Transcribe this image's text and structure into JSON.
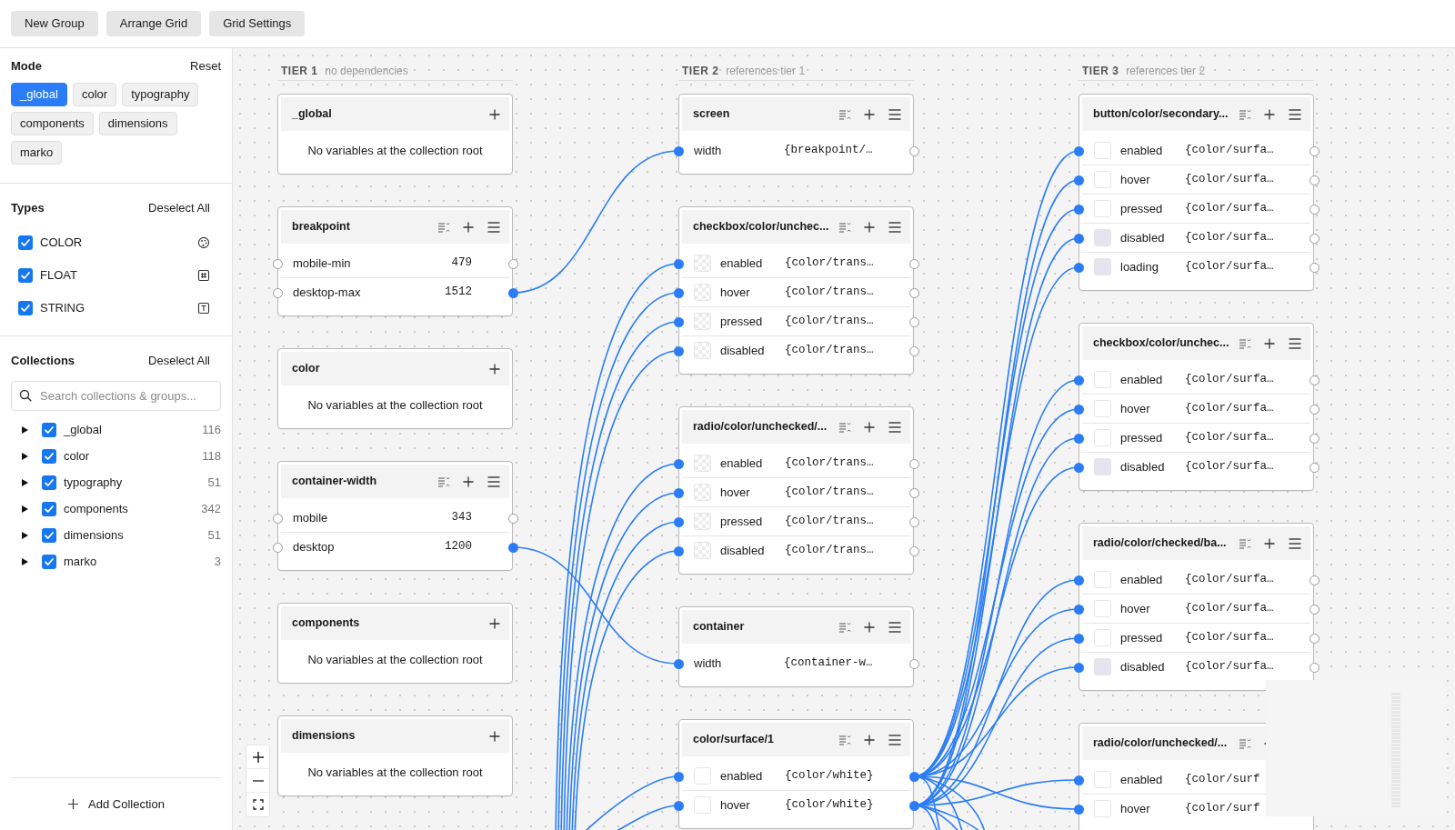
{
  "toolbar": {
    "buttons": [
      "New Group",
      "Arrange Grid",
      "Grid Settings"
    ]
  },
  "sidebar": {
    "mode": {
      "title": "Mode",
      "reset": "Reset",
      "modes": [
        {
          "label": "_global",
          "selected": true
        },
        {
          "label": "color",
          "selected": false
        },
        {
          "label": "typography",
          "selected": false
        },
        {
          "label": "components",
          "selected": false
        },
        {
          "label": "dimensions",
          "selected": false
        },
        {
          "label": "marko",
          "selected": false
        }
      ]
    },
    "types": {
      "title": "Types",
      "action": "Deselect All",
      "items": [
        {
          "label": "COLOR",
          "kind": "color",
          "checked": true
        },
        {
          "label": "FLOAT",
          "kind": "float",
          "checked": true
        },
        {
          "label": "STRING",
          "kind": "string",
          "checked": true
        }
      ]
    },
    "collections": {
      "title": "Collections",
      "action": "Deselect All",
      "search": {
        "placeholder": "Search collections & groups..."
      },
      "items": [
        {
          "label": "_global",
          "count": "116",
          "checked": true,
          "expanded": false
        },
        {
          "label": "color",
          "count": "118",
          "checked": true,
          "expanded": false
        },
        {
          "label": "typography",
          "count": "51",
          "checked": true,
          "expanded": false
        },
        {
          "label": "components",
          "count": "342",
          "checked": true,
          "expanded": false
        },
        {
          "label": "dimensions",
          "count": "51",
          "checked": true,
          "expanded": false
        },
        {
          "label": "marko",
          "count": "3",
          "checked": true,
          "expanded": false
        }
      ]
    },
    "add_collection": "Add Collection"
  },
  "canvas": {
    "tiers": [
      {
        "label": "TIER 1",
        "note": "no dependencies",
        "nodes": [
          {
            "title": "_global",
            "empty_text": "No variables at the collection root"
          },
          {
            "title": "breakpoint",
            "rows": [
              {
                "kind": "number",
                "name": "mobile-min",
                "value": "479",
                "in_linked": false,
                "out_linked": false
              },
              {
                "kind": "number",
                "name": "desktop-max",
                "value": "1512",
                "in_linked": false,
                "out_linked": true
              }
            ]
          },
          {
            "title": "color",
            "empty_text": "No variables at the collection root"
          },
          {
            "title": "container-width",
            "rows": [
              {
                "kind": "number",
                "name": "mobile",
                "value": "343",
                "in_linked": false,
                "out_linked": false
              },
              {
                "kind": "number",
                "name": "desktop",
                "value": "1200",
                "in_linked": false,
                "out_linked": true
              }
            ]
          },
          {
            "title": "components",
            "empty_text": "No variables at the collection root"
          },
          {
            "title": "dimensions",
            "empty_text": "No variables at the collection root"
          }
        ]
      },
      {
        "label": "TIER 2",
        "note": "references tier 1",
        "nodes": [
          {
            "title": "screen",
            "rows": [
              {
                "kind": "alias",
                "name": "width",
                "value": "{breakpoint/…",
                "in_linked": true,
                "out_linked": false
              }
            ]
          },
          {
            "title": "checkbox/color/unchec...",
            "rows": [
              {
                "kind": "color",
                "transparent": true,
                "name": "enabled",
                "value": "{color/trans…",
                "in_linked": true,
                "out_linked": false
              },
              {
                "kind": "color",
                "transparent": true,
                "name": "hover",
                "value": "{color/trans…",
                "in_linked": true,
                "out_linked": false
              },
              {
                "kind": "color",
                "transparent": true,
                "name": "pressed",
                "value": "{color/trans…",
                "in_linked": true,
                "out_linked": false
              },
              {
                "kind": "color",
                "transparent": true,
                "name": "disabled",
                "value": "{color/trans…",
                "in_linked": true,
                "out_linked": false
              }
            ]
          },
          {
            "title": "radio/color/unchecked/...",
            "rows": [
              {
                "kind": "color",
                "transparent": true,
                "name": "enabled",
                "value": "{color/trans…",
                "in_linked": true,
                "out_linked": false
              },
              {
                "kind": "color",
                "transparent": true,
                "name": "hover",
                "value": "{color/trans…",
                "in_linked": true,
                "out_linked": false
              },
              {
                "kind": "color",
                "transparent": true,
                "name": "pressed",
                "value": "{color/trans…",
                "in_linked": true,
                "out_linked": false
              },
              {
                "kind": "color",
                "transparent": true,
                "name": "disabled",
                "value": "{color/trans…",
                "in_linked": true,
                "out_linked": false
              }
            ]
          },
          {
            "title": "container",
            "rows": [
              {
                "kind": "alias",
                "name": "width",
                "value": "{container-w…",
                "in_linked": true,
                "out_linked": false
              }
            ]
          },
          {
            "title": "color/surface/1",
            "rows": [
              {
                "kind": "color",
                "transparent": false,
                "color": "#ffffff",
                "name": "enabled",
                "value": "{color/white}",
                "in_linked": true,
                "out_linked": true
              },
              {
                "kind": "color",
                "transparent": false,
                "color": "#ffffff",
                "name": "hover",
                "value": "{color/white}",
                "in_linked": true,
                "out_linked": true
              }
            ]
          }
        ]
      },
      {
        "label": "TIER 3",
        "note": "references tier 2",
        "nodes": [
          {
            "title": "button/color/secondary...",
            "rows": [
              {
                "kind": "color",
                "transparent": false,
                "color": "#ffffff",
                "name": "enabled",
                "value": "{color/surfa…",
                "in_linked": true,
                "out_linked": false
              },
              {
                "kind": "color",
                "transparent": false,
                "color": "#ffffff",
                "name": "hover",
                "value": "{color/surfa…",
                "in_linked": true,
                "out_linked": false
              },
              {
                "kind": "color",
                "transparent": false,
                "color": "#ffffff",
                "name": "pressed",
                "value": "{color/surfa…",
                "in_linked": true,
                "out_linked": false
              },
              {
                "kind": "color",
                "transparent": false,
                "color": "#e5e5ef",
                "name": "disabled",
                "value": "{color/surfa…",
                "in_linked": true,
                "out_linked": false
              },
              {
                "kind": "color",
                "transparent": false,
                "color": "#e5e5ef",
                "name": "loading",
                "value": "{color/surfa…",
                "in_linked": true,
                "out_linked": false
              }
            ]
          },
          {
            "title": "checkbox/color/unchec...",
            "rows": [
              {
                "kind": "color",
                "transparent": false,
                "color": "#ffffff",
                "name": "enabled",
                "value": "{color/surfa…",
                "in_linked": true,
                "out_linked": false
              },
              {
                "kind": "color",
                "transparent": false,
                "color": "#ffffff",
                "name": "hover",
                "value": "{color/surfa…",
                "in_linked": true,
                "out_linked": false
              },
              {
                "kind": "color",
                "transparent": false,
                "color": "#ffffff",
                "name": "pressed",
                "value": "{color/surfa…",
                "in_linked": true,
                "out_linked": false
              },
              {
                "kind": "color",
                "transparent": false,
                "color": "#e5e5ef",
                "name": "disabled",
                "value": "{color/surfa…",
                "in_linked": true,
                "out_linked": false
              }
            ]
          },
          {
            "title": "radio/color/checked/ba...",
            "rows": [
              {
                "kind": "color",
                "transparent": false,
                "color": "#ffffff",
                "name": "enabled",
                "value": "{color/surfa…",
                "in_linked": true,
                "out_linked": false
              },
              {
                "kind": "color",
                "transparent": false,
                "color": "#ffffff",
                "name": "hover",
                "value": "{color/surfa…",
                "in_linked": true,
                "out_linked": false
              },
              {
                "kind": "color",
                "transparent": false,
                "color": "#ffffff",
                "name": "pressed",
                "value": "{color/surfa…",
                "in_linked": true,
                "out_linked": false
              },
              {
                "kind": "color",
                "transparent": false,
                "color": "#e5e5ef",
                "name": "disabled",
                "value": "{color/surfa…",
                "in_linked": true,
                "out_linked": false
              }
            ]
          },
          {
            "title": "radio/color/unchecked/...",
            "rows": [
              {
                "kind": "color",
                "transparent": false,
                "color": "#ffffff",
                "name": "enabled",
                "value": "{color/surf",
                "in_linked": true
              },
              {
                "kind": "color",
                "transparent": false,
                "color": "#ffffff",
                "name": "hover",
                "value": "{color/surf",
                "in_linked": true
              }
            ]
          }
        ]
      }
    ],
    "minimap": true
  }
}
